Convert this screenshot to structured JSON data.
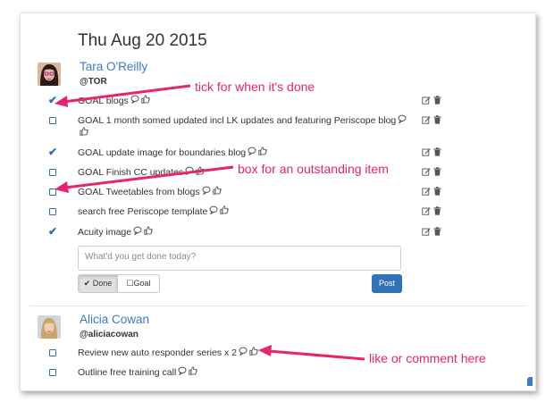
{
  "date": "Thu Aug 20 2015",
  "users": [
    {
      "name": "Tara O'Reilly",
      "handle": "@TOR",
      "items": [
        {
          "text": "GOAL blogs",
          "done": true
        },
        {
          "text": "GOAL 1 month somed updated incl LK updates and featuring Periscope blog",
          "done": false
        },
        {
          "text": "GOAL update image for boundaries blog",
          "done": true
        },
        {
          "text": "GOAL Finish CC updates",
          "done": false
        },
        {
          "text": "GOAL Tweetables from blogs",
          "done": false
        },
        {
          "text": "search free Periscope template",
          "done": false
        },
        {
          "text": "Acuity image",
          "done": true
        }
      ],
      "compose": {
        "placeholder": "What'd you get done today?",
        "done_label": "Done",
        "goal_label": "Goal",
        "post_label": "Post"
      }
    },
    {
      "name": "Alicia Cowan",
      "handle": "@aliciacowan",
      "items": [
        {
          "text": "Review new auto responder series x 2",
          "done": false
        },
        {
          "text": "Outline free training call",
          "done": false
        }
      ]
    }
  ],
  "annotations": {
    "tick": "tick for when it's done",
    "box": "box for an outstanding item",
    "like": "like or comment here"
  },
  "colors": {
    "accent": "#3a7bbf",
    "annotation": "#e8236f",
    "post_button": "#3072b5"
  },
  "icons": {
    "comment": "comment-icon",
    "like": "thumbs-up-icon",
    "edit": "edit-icon",
    "delete": "trash-icon",
    "checkmark": "checkmark-icon",
    "checkbox": "checkbox-icon"
  }
}
